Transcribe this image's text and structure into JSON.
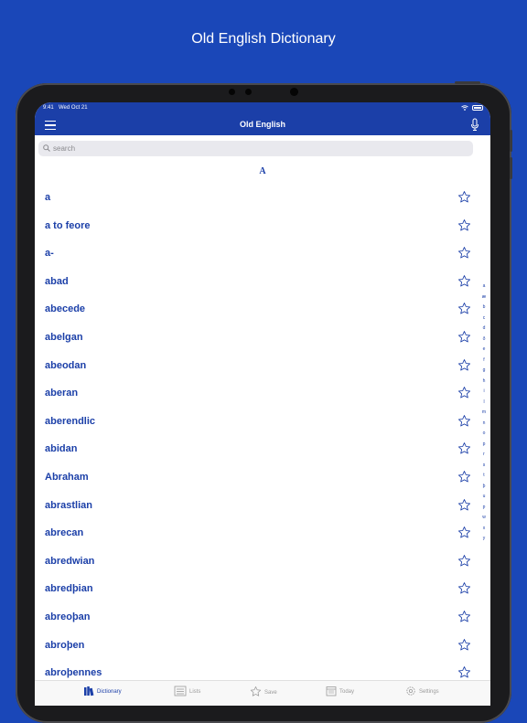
{
  "headline": "Old English Dictionary",
  "status": {
    "time": "9:41",
    "date": "Wed Oct 21"
  },
  "nav": {
    "title": "Old English"
  },
  "search": {
    "placeholder": "search"
  },
  "section": "A",
  "words": [
    {
      "label": "a"
    },
    {
      "label": "a to feore"
    },
    {
      "label": "a-"
    },
    {
      "label": "abad"
    },
    {
      "label": "abecede"
    },
    {
      "label": "abelgan"
    },
    {
      "label": "abeodan"
    },
    {
      "label": "aberan"
    },
    {
      "label": "aberendlic"
    },
    {
      "label": "abidan"
    },
    {
      "label": "Abraham"
    },
    {
      "label": "abrastlian"
    },
    {
      "label": "abrecan"
    },
    {
      "label": "abredwian"
    },
    {
      "label": "abredþian"
    },
    {
      "label": "abreoþan"
    },
    {
      "label": "abroþen"
    },
    {
      "label": "abroþennes"
    }
  ],
  "index": [
    "a",
    "æ",
    "b",
    "c",
    "d",
    "ð",
    "e",
    "f",
    "g",
    "h",
    "i",
    "l",
    "m",
    "n",
    "o",
    "p",
    "r",
    "s",
    "t",
    "þ",
    "u",
    "ƿ",
    "w",
    "x",
    "y"
  ],
  "tabs": [
    {
      "label": "Dictionary",
      "icon": "dictionary-icon",
      "active": true
    },
    {
      "label": "Lists",
      "icon": "lists-icon",
      "active": false
    },
    {
      "label": "Save",
      "icon": "star-icon",
      "active": false
    },
    {
      "label": "Today",
      "icon": "calendar-icon",
      "active": false
    },
    {
      "label": "Settings",
      "icon": "gear-icon",
      "active": false
    }
  ],
  "colors": {
    "background": "#1a47b8",
    "brand": "#1b3fa8",
    "inactive": "#9a9a9a"
  }
}
